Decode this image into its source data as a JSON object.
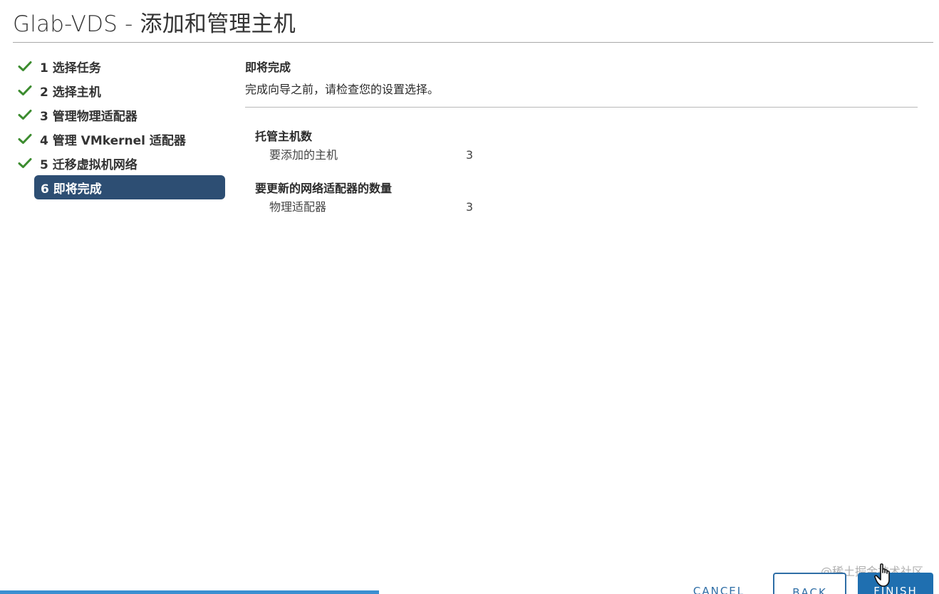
{
  "window": {
    "title": "Glab-VDS - 添加和管理主机"
  },
  "steps": [
    {
      "label": "1 选择任务",
      "status": "complete"
    },
    {
      "label": "2 选择主机",
      "status": "complete"
    },
    {
      "label": "3 管理物理适配器",
      "status": "complete"
    },
    {
      "label": "4 管理 VMkernel 适配器",
      "status": "complete"
    },
    {
      "label": "5 迁移虚拟机网络",
      "status": "complete"
    },
    {
      "label": "6 即将完成",
      "status": "active"
    }
  ],
  "main": {
    "heading": "即将完成",
    "description": "完成向导之前，请检查您的设置选择。",
    "groups": [
      {
        "title": "托管主机数",
        "rows": [
          {
            "label": "要添加的主机",
            "value": "3"
          }
        ]
      },
      {
        "title": "要更新的网络适配器的数量",
        "rows": [
          {
            "label": "物理适配器",
            "value": "3"
          }
        ]
      }
    ]
  },
  "footer": {
    "cancel_label": "CANCEL",
    "back_label": "BACK",
    "finish_label": "FINISH"
  },
  "watermark": "@稀土掘金技术社区",
  "colors": {
    "check_green": "#3c8c2f",
    "active_step_bg": "#2d4e73",
    "primary_blue": "#1f6fb0",
    "link_blue": "#2f6ea6"
  },
  "icons": {
    "step_complete": "check-icon",
    "pointer": "hand-cursor-icon"
  }
}
